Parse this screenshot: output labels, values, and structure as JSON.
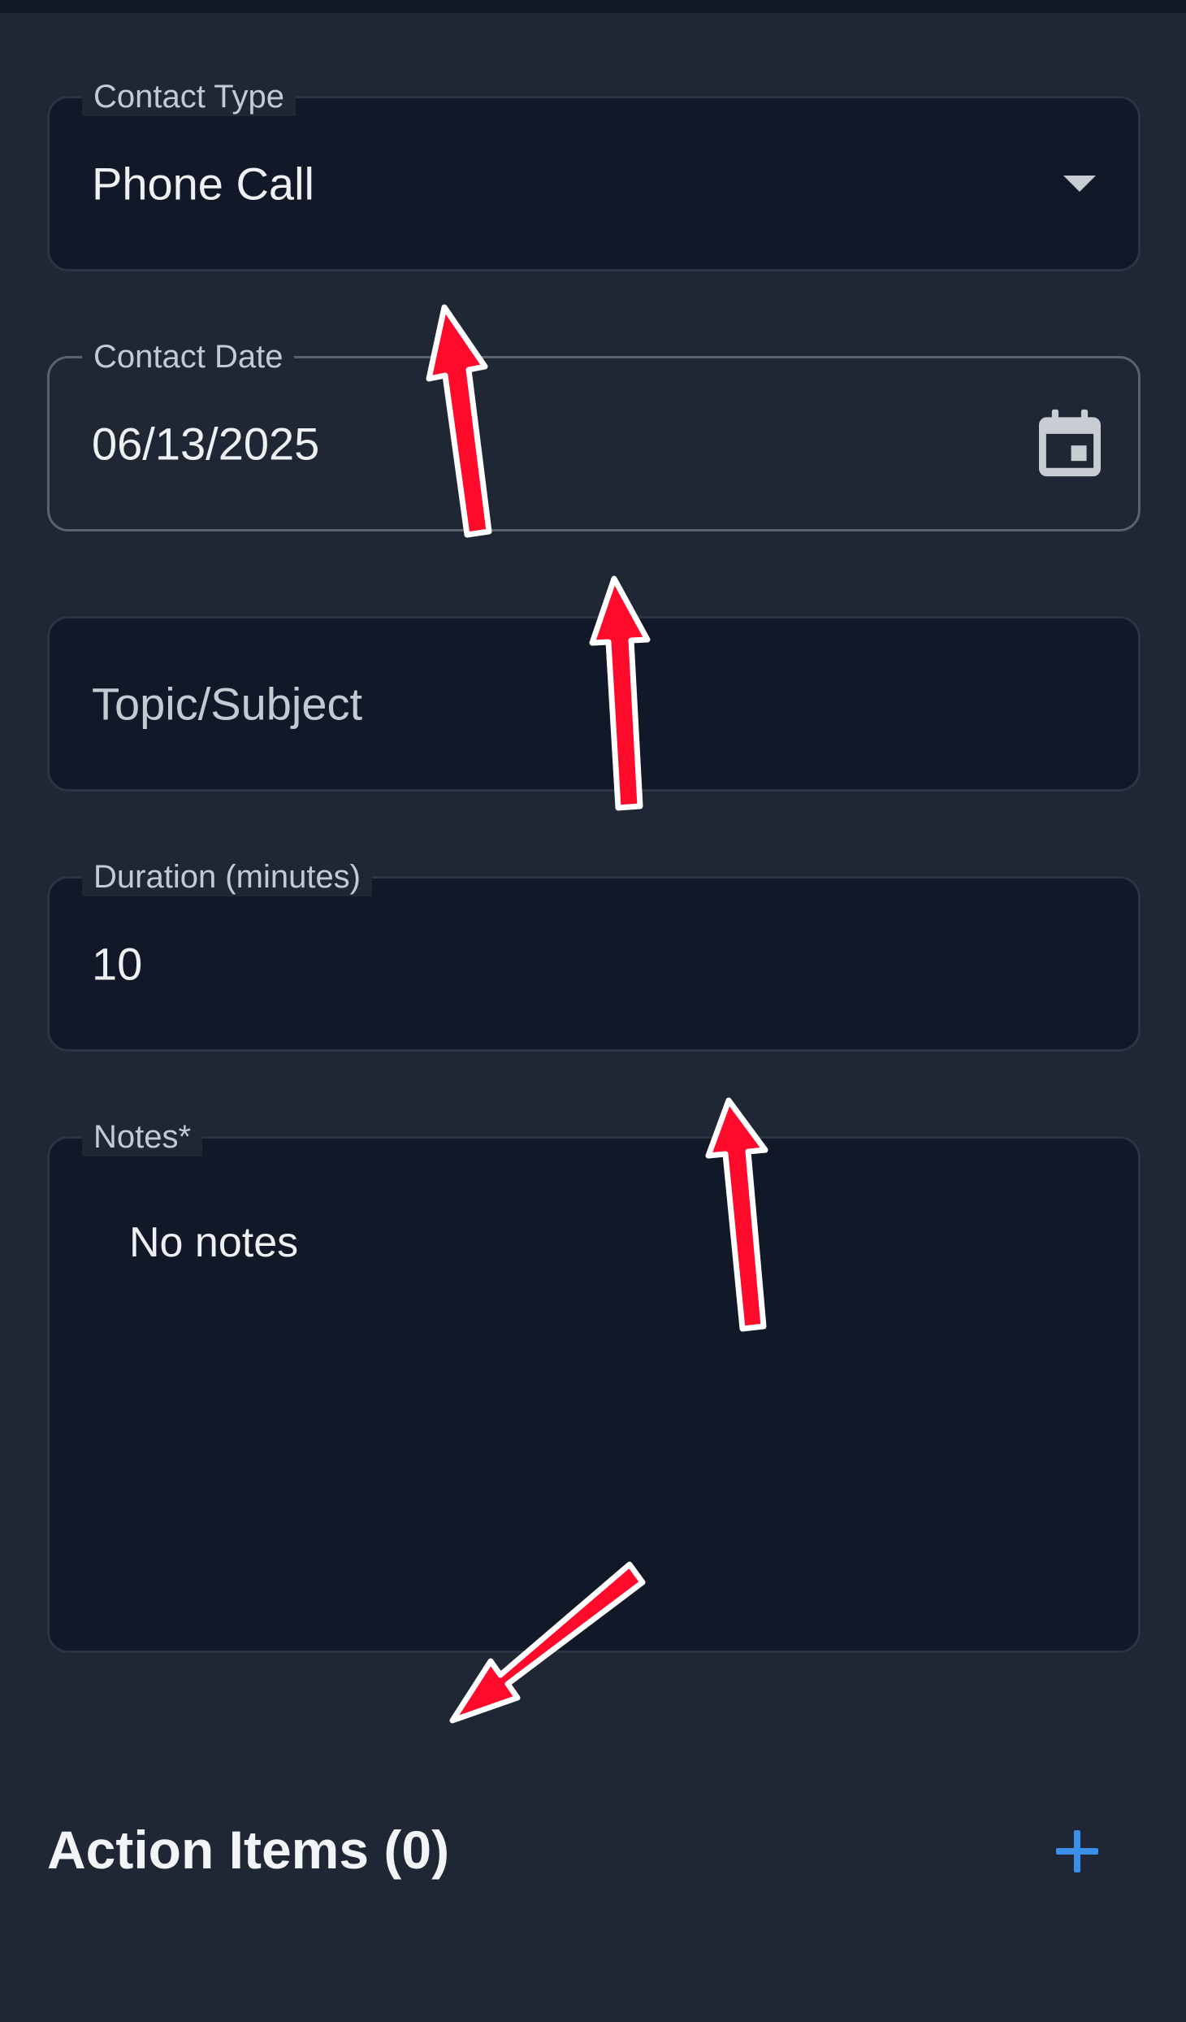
{
  "form": {
    "contact_type": {
      "label": "Contact Type",
      "value": "Phone Call"
    },
    "contact_date": {
      "label": "Contact Date",
      "value": "06/13/2025"
    },
    "topic": {
      "placeholder": "Topic/Subject"
    },
    "duration": {
      "label": "Duration (minutes)",
      "value": "10"
    },
    "notes": {
      "label": "Notes*",
      "value": "No notes"
    }
  },
  "action_items": {
    "title": "Action Items (0)"
  },
  "icons": {
    "dropdown": "chevron-down-icon",
    "calendar": "calendar-icon",
    "add": "plus-icon",
    "annotation": "arrow-icon"
  },
  "colors": {
    "background": "#1f2735",
    "field_background": "#111827",
    "accent": "#3b8fe8",
    "annotation_arrow": "#ff0a2b"
  }
}
